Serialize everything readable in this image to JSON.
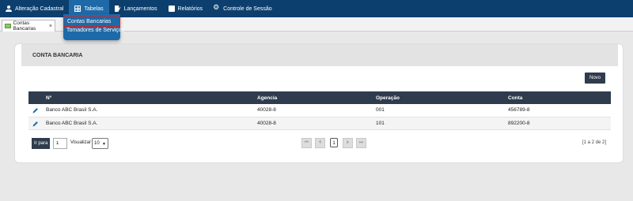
{
  "menubar": {
    "items": [
      {
        "label": "Alteração Cadastral",
        "icon": "user-icon"
      },
      {
        "label": "Tabelas",
        "icon": "table-icon"
      },
      {
        "label": "Lançamentos",
        "icon": "edit-icon"
      },
      {
        "label": "Relatórios",
        "icon": "report-icon"
      },
      {
        "label": "Controle de Sessão",
        "icon": "gear-icon"
      }
    ]
  },
  "dropdown": {
    "items": [
      "Contas Bancarias",
      "Tomadores de Serviços"
    ]
  },
  "tabstrip": {
    "tab_label": "Contas Bancarias",
    "close": "×"
  },
  "panel": {
    "title": "CONTA BANCARIA",
    "new_button": "Novo",
    "columns": [
      "Nº",
      "Agencia",
      "Operação",
      "Conta"
    ],
    "rows": [
      {
        "banco": "Banco ABC Brasil S.A.",
        "agencia": "40028-8",
        "operacao": "001",
        "conta": "456789-8"
      },
      {
        "banco": "Banco ABC Brasil S.A.",
        "agencia": "40028-8",
        "operacao": "101",
        "conta": "892200-8"
      }
    ],
    "footer": {
      "goto_label": "Ir para",
      "page_value": "1",
      "view_label": "Visualizar",
      "page_size": "10",
      "first": "⏮",
      "prev": "⏴",
      "current_page": "1",
      "next": "⏵",
      "last": "⏭",
      "range": "[1 a 2 de 2]"
    }
  },
  "colors": {
    "menubar": "#0d3f6e",
    "menu_active": "#1e6aa8",
    "header_dark": "#2f3c4d",
    "highlight": "#d9211f"
  }
}
